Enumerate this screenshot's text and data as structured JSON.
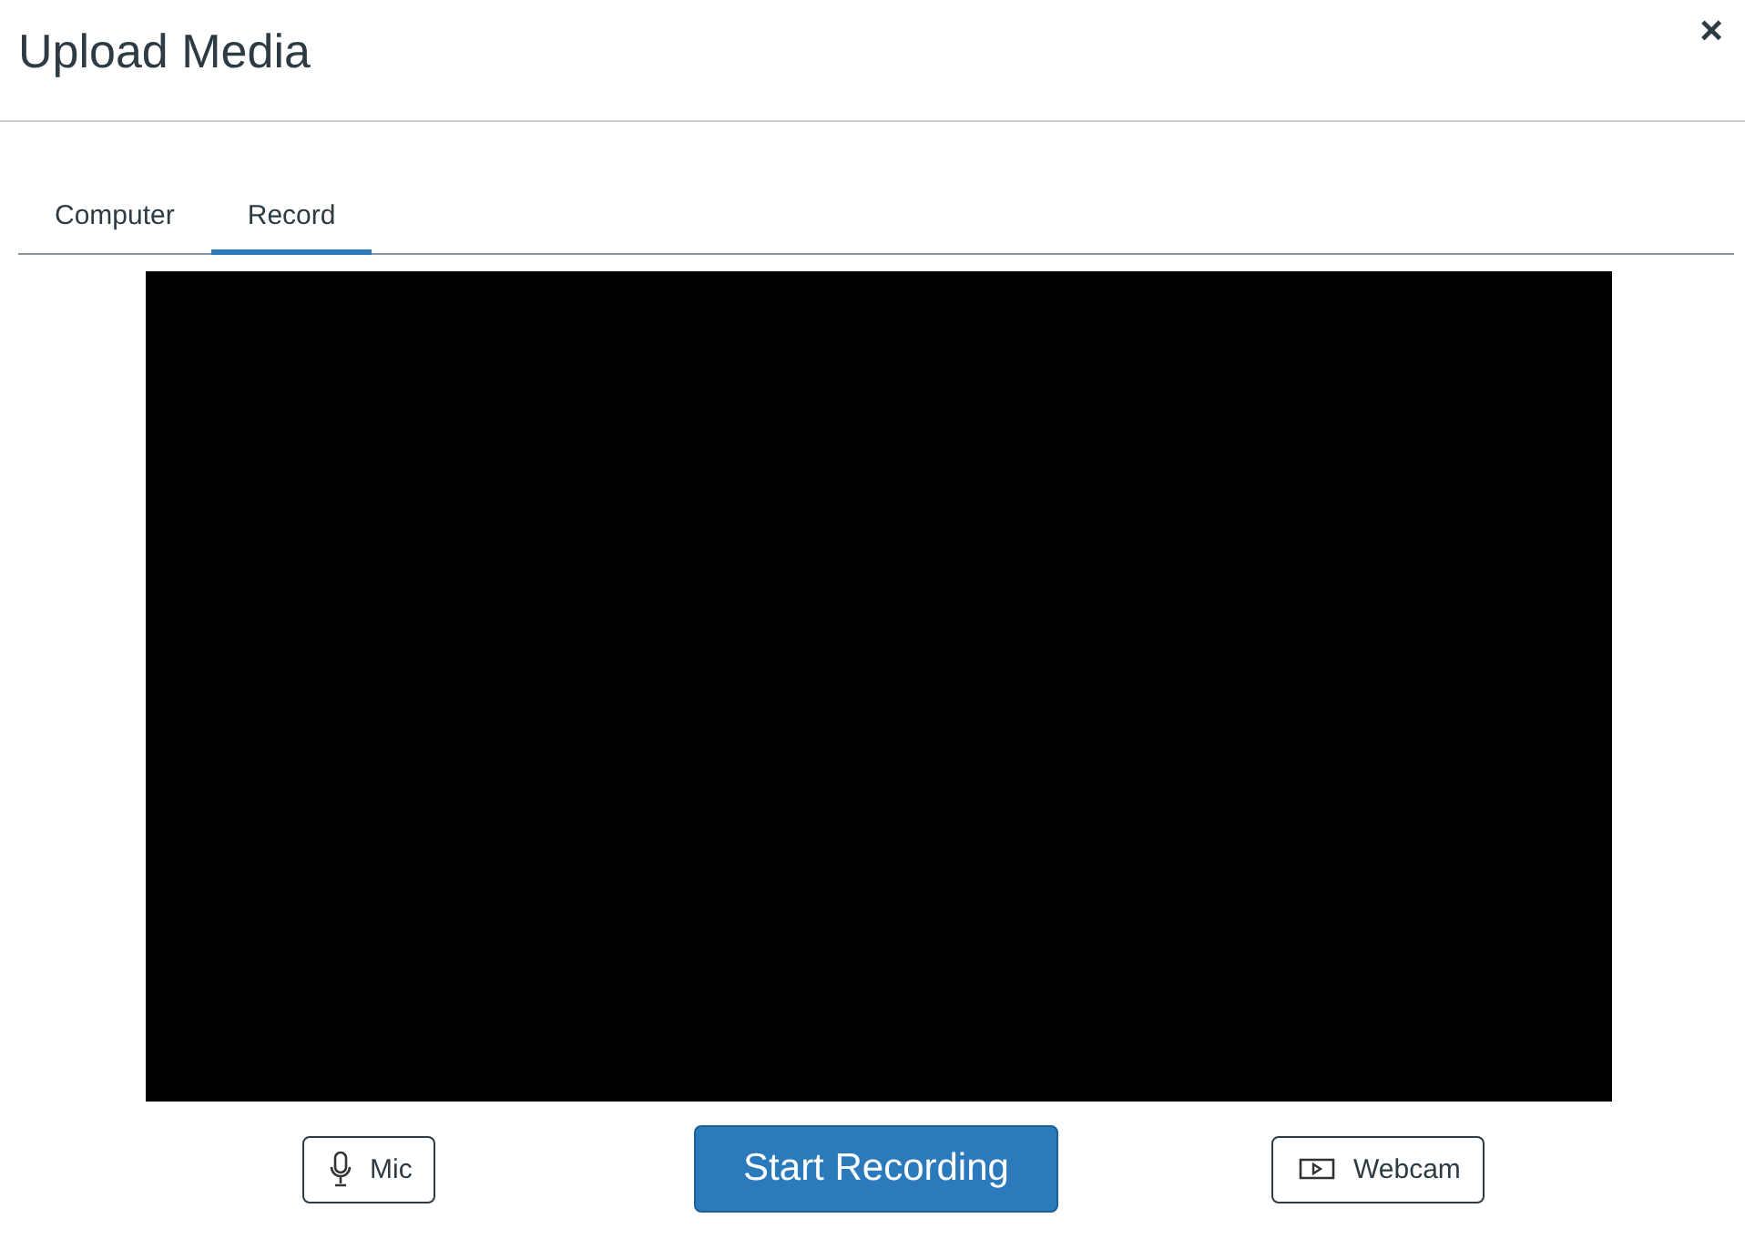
{
  "dialog": {
    "title": "Upload Media",
    "close": "×"
  },
  "tabs": [
    {
      "label": "Computer",
      "selected": false
    },
    {
      "label": "Record",
      "selected": true
    }
  ],
  "controls": [
    {
      "kind": "mic",
      "label": "Mic"
    },
    {
      "kind": "primary",
      "label": "Start Recording"
    },
    {
      "kind": "webcam",
      "label": "Webcam"
    }
  ]
}
